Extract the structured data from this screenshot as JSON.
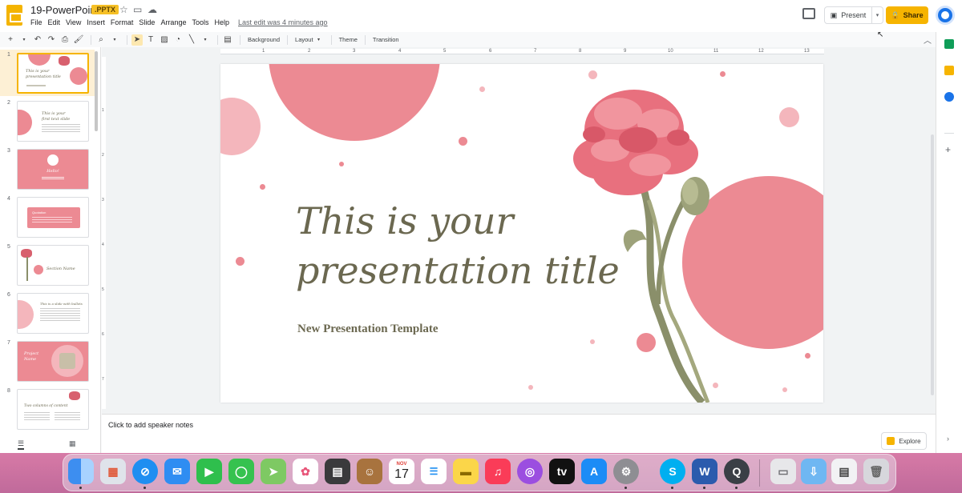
{
  "app": {
    "doc_title": "19-PowerPoint",
    "file_badge": ".PPTX",
    "last_edit": "Last edit was 4 minutes ago",
    "present_label": "Present",
    "share_label": "Share",
    "brand_color": "#f4b400"
  },
  "menu": [
    "File",
    "Edit",
    "View",
    "Insert",
    "Format",
    "Slide",
    "Arrange",
    "Tools",
    "Help"
  ],
  "toolbar": {
    "background_label": "Background",
    "layout_label": "Layout",
    "theme_label": "Theme",
    "transition_label": "Transition"
  },
  "ruler": {
    "h_ticks": [
      "1",
      "2",
      "3",
      "4",
      "5",
      "6",
      "7",
      "8",
      "9",
      "10",
      "11",
      "12",
      "13"
    ],
    "v_ticks": [
      "1",
      "2",
      "3",
      "4",
      "5",
      "6",
      "7"
    ]
  },
  "slides": [
    {
      "num": "1",
      "label": "This is your presentation title"
    },
    {
      "num": "2",
      "label": "This is your first text slide"
    },
    {
      "num": "3",
      "label": "Hello!"
    },
    {
      "num": "4",
      "label": "Quotation"
    },
    {
      "num": "5",
      "label": "Section Name"
    },
    {
      "num": "6",
      "label": "This is a slide with bullets"
    },
    {
      "num": "7",
      "label": "Project Name"
    },
    {
      "num": "8",
      "label": "Two columns of content"
    }
  ],
  "slide": {
    "title": "This is your\npresentation title",
    "subtitle": "New Presentation Template",
    "accent_color": "#ec8a93",
    "text_color": "#6b6850"
  },
  "notes": {
    "placeholder": "Click to add speaker notes",
    "explore_label": "Explore"
  },
  "dock": {
    "calendar_month": "NOV",
    "calendar_day": "17",
    "apps": [
      "Finder",
      "Launchpad",
      "Safari",
      "Mail",
      "FaceTime",
      "Messages",
      "Maps",
      "Photos",
      "Calculator",
      "Contacts",
      "Calendar",
      "Reminders",
      "Notes",
      "Music",
      "Podcasts",
      "TV",
      "App Store",
      "System Preferences",
      "Skype",
      "Word",
      "QuickTime",
      "Preview",
      "Downloads",
      "Documents",
      "Trash"
    ]
  }
}
